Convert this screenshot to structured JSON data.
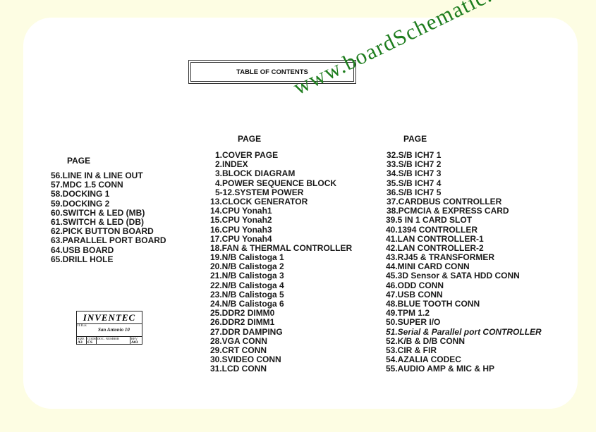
{
  "title": "TABLE OF CONTENTS",
  "watermark": "www.boardSchematic.com",
  "page_header": "PAGE",
  "left_column": [
    "56.LINE IN & LINE OUT",
    "57.MDC 1.5 CONN",
    "58.DOCKING 1",
    "59.DOCKING 2",
    "60.SWITCH & LED (MB)",
    "61.SWITCH & LED (DB)",
    "62.PICK BUTTON BOARD",
    "63.PARALLEL PORT BOARD",
    "64.USB BOARD",
    "65.DRILL HOLE"
  ],
  "middle_column": [
    "1.COVER PAGE",
    "2.INDEX",
    "3.BLOCK DIAGRAM",
    "4.POWER SEQUENCE BLOCK",
    "5-12.SYSTEM POWER",
    "13.CLOCK GENERATOR",
    "14.CPU Yonah1",
    "15.CPU Yonah2",
    "16.CPU Yonah3",
    "17.CPU Yonah4",
    "18.FAN & THERMAL CONTROLLER",
    "19.N/B Calistoga 1",
    "20.N/B Calistoga 2",
    "21.N/B Calistoga 3",
    "22.N/B Calistoga 4",
    "23.N/B Calistoga 5",
    "24.N/B Calistoga 6",
    "25.DDR2 DIMM0",
    "26.DDR2 DIMM1",
    "27.DDR DAMPING",
    "28.VGA CONN",
    "29.CRT CONN",
    "30.SVIDEO CONN",
    "31.LCD CONN"
  ],
  "right_column": [
    "32.S/B ICH7 1",
    "33.S/B ICH7 2",
    "34.S/B ICH7 3",
    "35.S/B ICH7 4",
    "36.S/B ICH7 5",
    "37.CARDBUS CONTROLLER",
    "38.PCMCIA & EXPRESS CARD",
    "39.5 IN 1 CARD SLOT",
    "40.1394 CONTROLLER",
    "41.LAN CONTROLLER-1",
    "42.LAN CONTROLLER-2",
    "43.RJ45 & TRANSFORMER",
    "44.MINI CARD CONN",
    "45.3D Sensor & SATA HDD CONN",
    "46.ODD CONN",
    "47.USB CONN",
    "48.BLUE TOOTH CONN",
    "49.TPM 1.2",
    "50.SUPER I/O",
    "51.Serial & Parallel port CONTROLLER",
    "52.K/B & D/B CONN",
    "53.CIR & FIR",
    "54.AZALIA CODEC",
    "55.AUDIO AMP & MIC & HP"
  ],
  "title_block": {
    "company": "INVENTEC",
    "title_label": "TITLE",
    "title": "San Antonio 10",
    "size_label": "SIZE",
    "size": "A3",
    "code_label": "CODE",
    "code": "CS",
    "doc_label": "DOC. NUMBER",
    "rev_label": "REV",
    "rev": "A03"
  }
}
